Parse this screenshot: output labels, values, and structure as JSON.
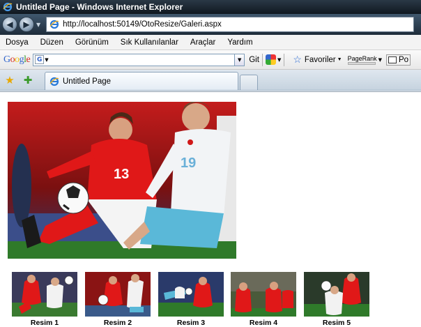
{
  "window": {
    "title": "Untitled Page - Windows Internet Explorer"
  },
  "address_bar": {
    "url": "http://localhost:50149/OtoResize/Galeri.aspx"
  },
  "menu": {
    "items": [
      "Dosya",
      "Düzen",
      "Görünüm",
      "Sık Kullanılanlar",
      "Araçlar",
      "Yardım"
    ]
  },
  "google_toolbar": {
    "logo": "Google",
    "search_value": "",
    "go_label": "Git",
    "favorites_label": "Favoriler",
    "pagerank_label": "PageRank",
    "popup_label": "Po"
  },
  "tabs": {
    "active_title": "Untitled Page"
  },
  "gallery": {
    "thumbnails": [
      {
        "label": "Resim 1"
      },
      {
        "label": "Resim 2"
      },
      {
        "label": "Resim 3"
      },
      {
        "label": "Resim 4"
      },
      {
        "label": "Resim 5"
      }
    ]
  },
  "icons": {
    "back": "back-arrow-icon",
    "forward": "forward-arrow-icon",
    "ie": "ie-logo-icon",
    "favorites_star": "favorites-star-icon",
    "add_favorite": "add-favorite-icon"
  }
}
